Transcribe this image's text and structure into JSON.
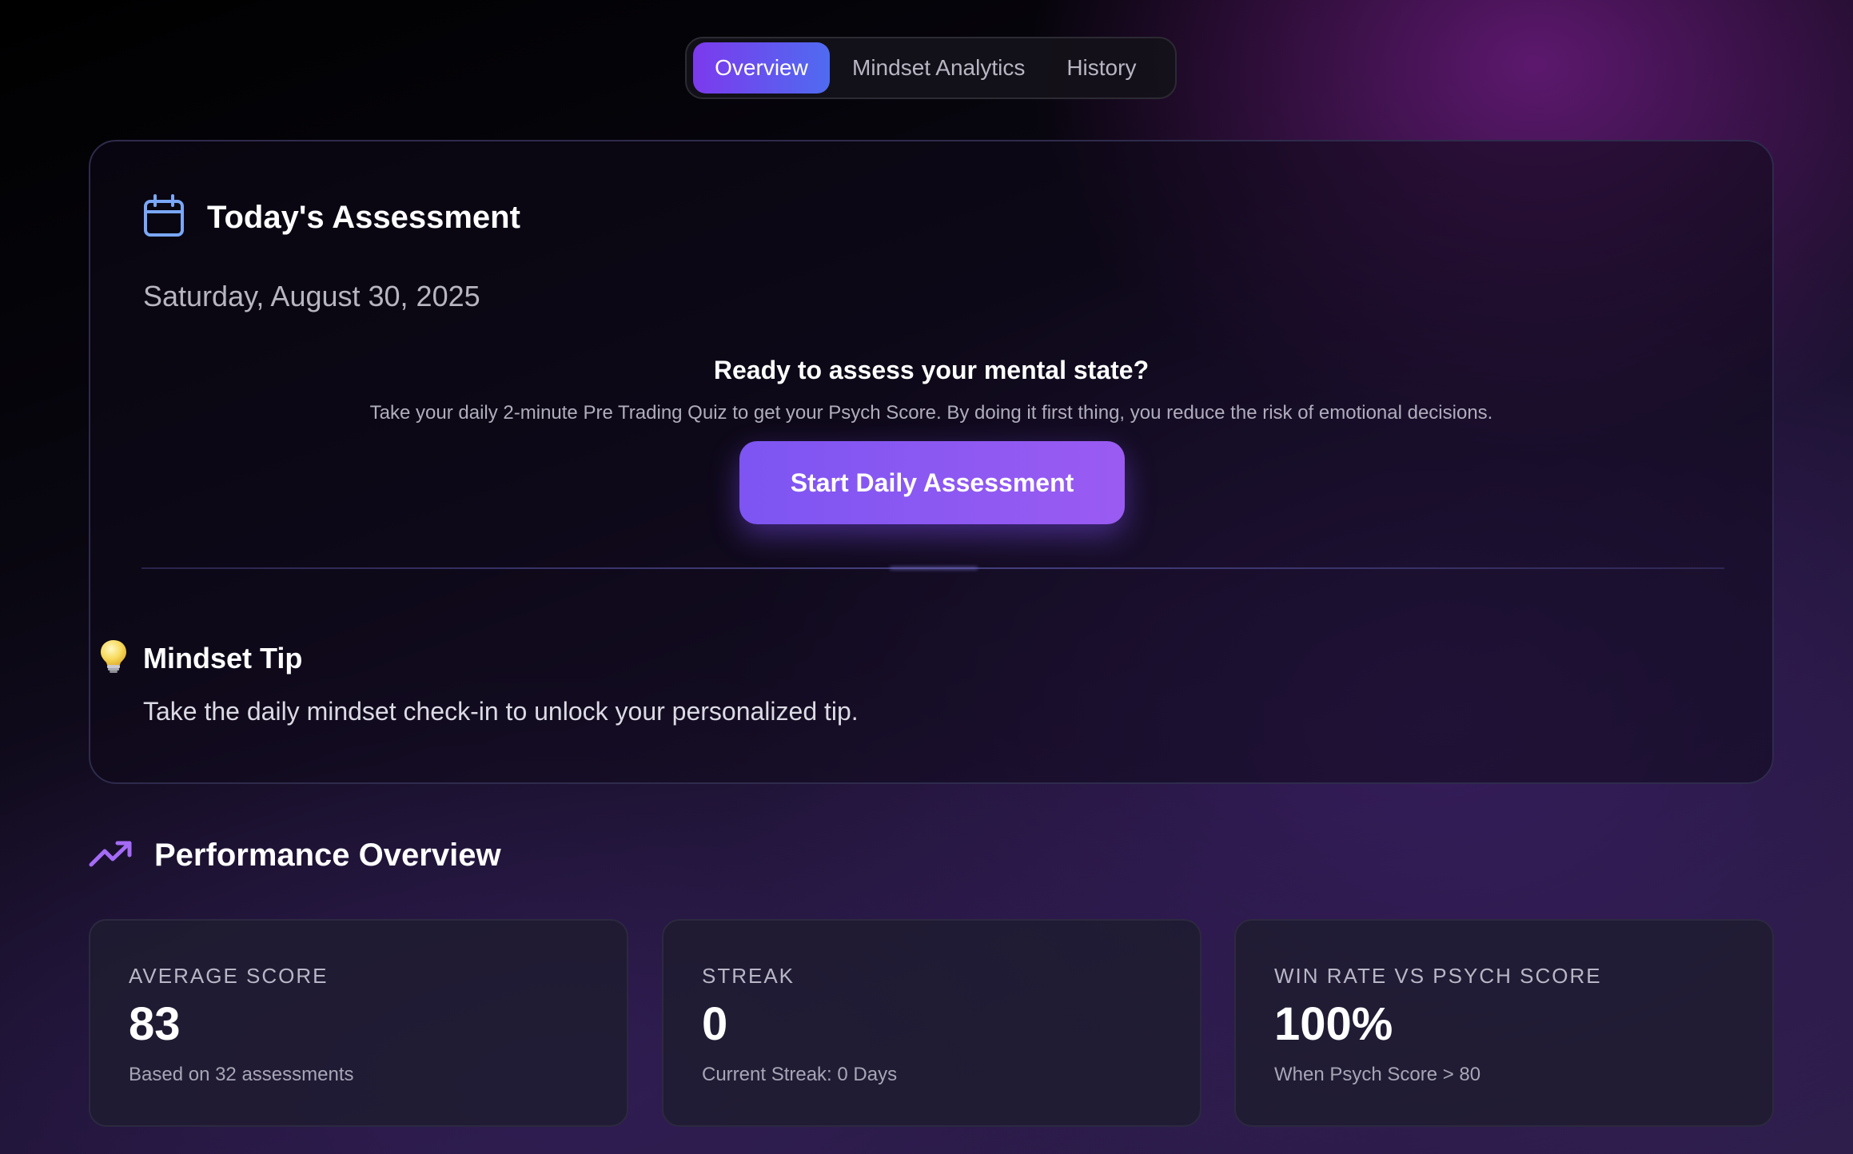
{
  "tabs": [
    {
      "label": "Overview",
      "active": true
    },
    {
      "label": "Mindset Analytics",
      "active": false
    },
    {
      "label": "History",
      "active": false
    }
  ],
  "assessment": {
    "title": "Today's Assessment",
    "title_icon": "calendar-icon",
    "date": "Saturday, August 30, 2025",
    "prompt_heading": "Ready to assess your mental state?",
    "prompt_text": "Take your daily 2-minute Pre Trading Quiz to get your Psych Score. By doing it first thing, you reduce the risk of emotional decisions.",
    "button_label": "Start Daily Assessment"
  },
  "tip": {
    "icon": "lightbulb-icon",
    "title": "Mindset Tip",
    "text": "Take the daily mindset check-in to unlock your personalized tip."
  },
  "performance": {
    "icon": "trending-up-icon",
    "title": "Performance Overview",
    "stats": [
      {
        "label": "AVERAGE SCORE",
        "value": "83",
        "sub": "Based on 32 assessments"
      },
      {
        "label": "STREAK",
        "value": "0",
        "sub": "Current Streak: 0 Days"
      },
      {
        "label": "WIN RATE VS PSYCH SCORE",
        "value": "100%",
        "sub": "When Psych Score > 80"
      }
    ]
  },
  "colors": {
    "accent_purple": "#7c3aed",
    "accent_blue": "#4f6bf0",
    "calendar_icon": "#7aa7f7",
    "trend_icon": "#a46bf5"
  }
}
